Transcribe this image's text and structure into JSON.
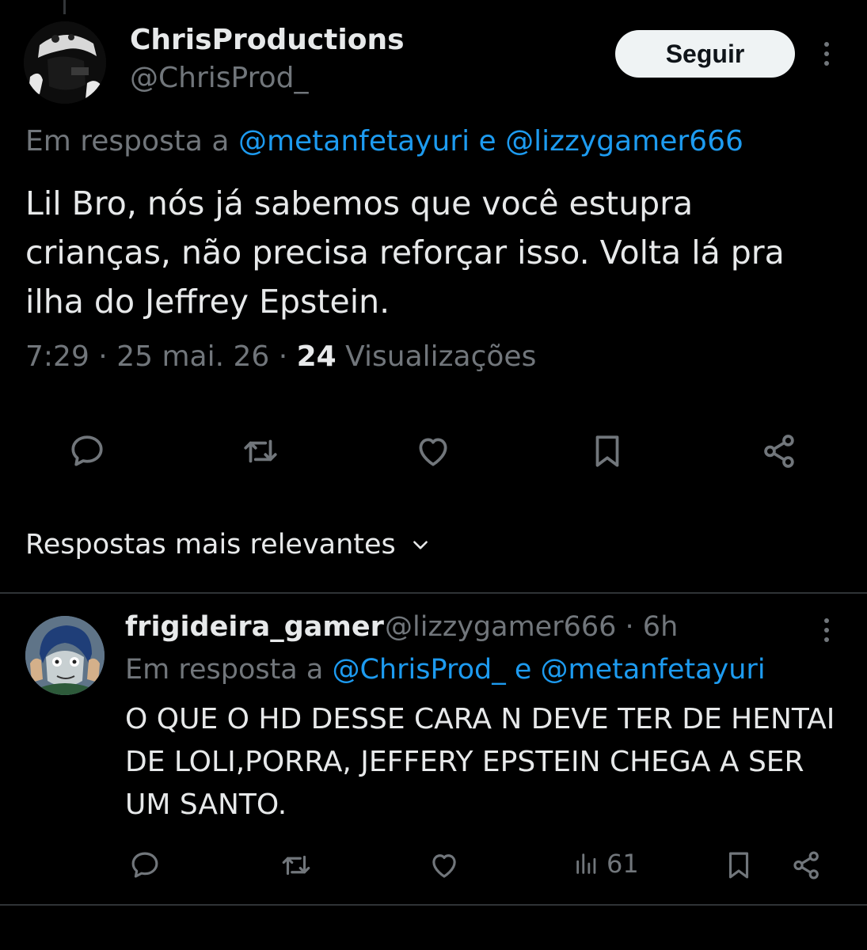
{
  "main_tweet": {
    "display_name": "ChrisProductions",
    "handle": "@ChrisProd_",
    "follow_label": "Seguir",
    "reply_prefix": "Em resposta a",
    "reply_mention_1": "@metanfetayuri",
    "reply_connector": "e",
    "reply_mention_2": "@lizzygamer666",
    "text": "Lil Bro, nós já sabemos que você estupra crianças, não precisa reforçar isso. Volta lá pra ilha do Jeffrey Epstein.",
    "time": "7:29",
    "date": "25 mai. 26",
    "views_count": "24",
    "views_label": "Visualizações",
    "actions": [
      "reply-icon",
      "retweet-icon",
      "like-icon",
      "bookmark-icon",
      "share-icon"
    ]
  },
  "sort": {
    "label": "Respostas mais relevantes"
  },
  "reply": {
    "display_name": "frigideira_gamer",
    "handle": "@lizzygamer666",
    "time": "6h",
    "reply_prefix": "Em resposta a",
    "reply_mention_1": "@ChrisProd_",
    "reply_connector": "e",
    "reply_mention_2": "@metanfetayuri",
    "text": "O QUE O HD DESSE CARA N DEVE TER DE HENTAI DE LOLI,PORRA, JEFFERY EPSTEIN CHEGA A SER UM SANTO.",
    "views": "61"
  },
  "colors": {
    "background": "#000000",
    "text": "#e7e9ea",
    "muted": "#71767b",
    "link": "#1d9bf0",
    "divider": "#2f3336"
  }
}
